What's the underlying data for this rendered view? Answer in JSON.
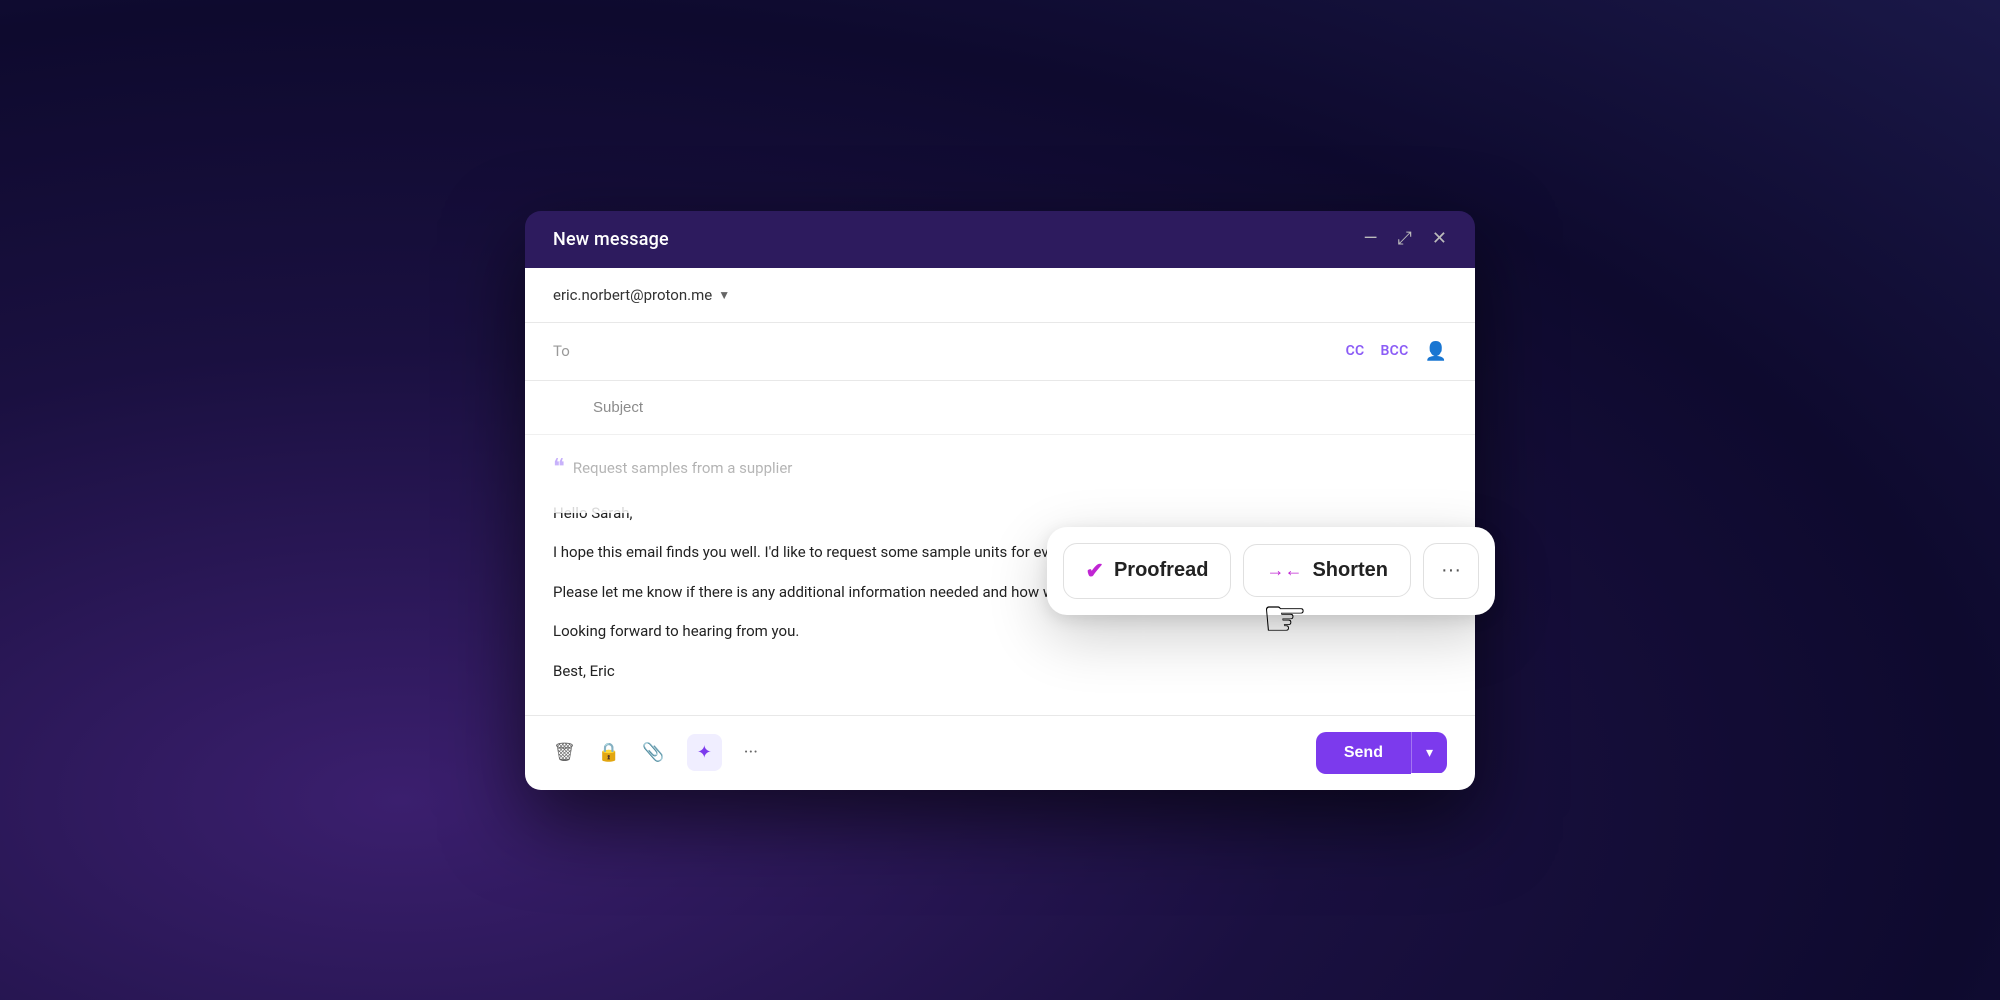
{
  "window": {
    "title": "New message",
    "minimize_icon": "—",
    "maximize_icon": "⤢",
    "close_icon": "✕"
  },
  "from": {
    "address": "eric.norbert@proton.me",
    "dropdown_arrow": "▼"
  },
  "to": {
    "label": "To",
    "placeholder": "",
    "cc": "CC",
    "bcc": "BCC"
  },
  "subject": {
    "label": "Subject",
    "placeholder": "Subject"
  },
  "body": {
    "ai_prompt": "Request samples from a supplier",
    "greeting": "Hello Sarah,",
    "paragraph1": "I hope this email finds you well. I'd like to request some sample units for evaluation purposes.",
    "paragraph2": "Please let me know if there is any additional information needed and how we can proceed with the shipment.",
    "paragraph3": "Looking forward to hearing from you.",
    "sign_off": "Best, Eric"
  },
  "toolbar": {
    "send_label": "Send",
    "dropdown_arrow": "▾"
  },
  "ai_popup": {
    "proofread_label": "Proofread",
    "shorten_label": "Shorten",
    "more_icon": "···"
  }
}
